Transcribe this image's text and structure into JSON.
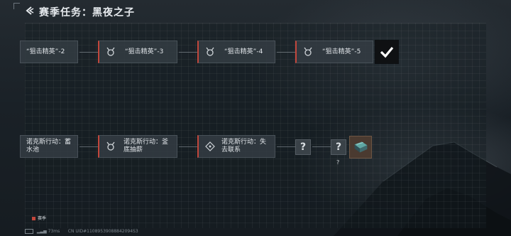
{
  "header": {
    "title": "赛季任务：黑夜之子",
    "back_icon": "back-arrow-icon"
  },
  "row1": [
    {
      "label": "“狙击精英”-2",
      "icon": "none"
    },
    {
      "label": "“狙击精英”-3",
      "icon": "bull-emblem-icon"
    },
    {
      "label": "“狙击精英”-4",
      "icon": "bull-emblem-icon"
    },
    {
      "label": "“狙击精英”-5",
      "icon": "bull-emblem-icon"
    }
  ],
  "row1_end": {
    "icon": "checkmark-icon"
  },
  "row2": [
    {
      "label": "诺克斯行动：蓄水池",
      "icon": "none"
    },
    {
      "label": "诺克斯行动：釜底抽薪",
      "icon": "bull-emblem-icon"
    },
    {
      "label": "诺克斯行动：失去联系",
      "icon": "crosshair-icon"
    }
  ],
  "row2_unknown": [
    {
      "symbol": "?"
    },
    {
      "symbol": "?",
      "caption": "?"
    }
  ],
  "row2_reward": {
    "icon": "supply-crate-icon"
  },
  "legend": {
    "label": "赛季",
    "color": "#c2463b"
  },
  "status": {
    "ping": "73ms",
    "uid": "CN UID#11089539088842094S3"
  }
}
